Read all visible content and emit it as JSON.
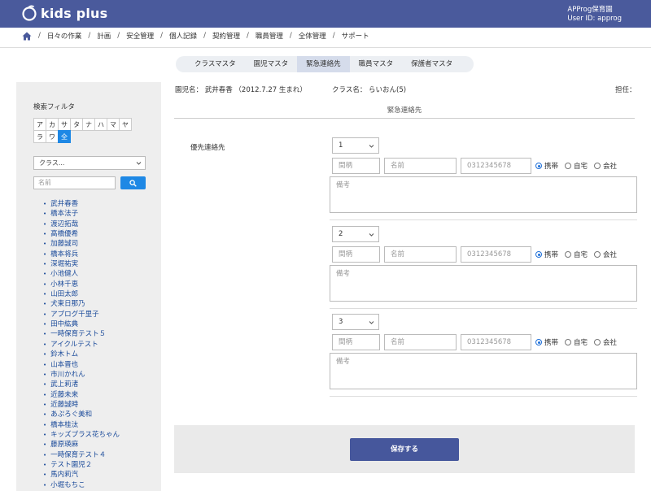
{
  "app": {
    "brand": "kids plus",
    "org_name": "APProg保育園",
    "user_id": "User ID: approg"
  },
  "breadcrumb": [
    "日々の作業",
    "計画",
    "安全管理",
    "個人記録",
    "契約管理",
    "職員管理",
    "全体管理",
    "サポート"
  ],
  "tabs": [
    {
      "label": "クラスマスタ",
      "active": false
    },
    {
      "label": "園児マスタ",
      "active": false
    },
    {
      "label": "緊急連絡先",
      "active": true
    },
    {
      "label": "職員マスタ",
      "active": false
    },
    {
      "label": "保護者マスタ",
      "active": false
    }
  ],
  "sidebar": {
    "filter_title": "検索フィルタ",
    "kana_row1": [
      "ア",
      "カ",
      "サ",
      "タ",
      "ナ",
      "ハ",
      "マ",
      "ヤ"
    ],
    "kana_row2": [
      "ラ",
      "ワ",
      "全"
    ],
    "class_select": "クラス...",
    "name_placeholder": "名前",
    "children": [
      "武井春香",
      "橋本法子",
      "渡辺拓哉",
      "高橋優希",
      "加藤誠司",
      "橋本将兵",
      "深堀祐実",
      "小池健人",
      "小林千恵",
      "山田太郎",
      "犬束日那乃",
      "アプログ千里子",
      "田中紘典",
      "一時保育テスト５",
      "アイクルテスト",
      "鈴木トム",
      "山本晋也",
      "市川かれん",
      "武上莉渚",
      "近藤未来",
      "近藤誠時",
      "あぷろぐ美和",
      "橋本桂汰",
      "キッズプラス花ちゃん",
      "藤原瑛麻",
      "一時保育テスト４",
      "テスト園児２",
      "馬内莉汽",
      "小堀もちこ"
    ]
  },
  "info": {
    "child": "園児名： 武井春香 （2012.7.27 生まれ）",
    "class": "クラス名： らいおん(5)",
    "teacher": "担任："
  },
  "section_title": "緊急連絡先",
  "priority_label": "優先連絡先",
  "contacts": [
    {
      "priority": "1",
      "relation_placeholder": "間柄",
      "name_placeholder": "名前",
      "phone_placeholder": "0312345678",
      "note_placeholder": "備考",
      "radio": [
        "携帯",
        "自宅",
        "会社"
      ]
    },
    {
      "priority": "2",
      "relation_placeholder": "間柄",
      "name_placeholder": "名前",
      "phone_placeholder": "0312345678",
      "note_placeholder": "備考",
      "radio": [
        "携帯",
        "自宅",
        "会社"
      ]
    },
    {
      "priority": "3",
      "relation_placeholder": "間柄",
      "name_placeholder": "名前",
      "phone_placeholder": "0312345678",
      "note_placeholder": "備考",
      "radio": [
        "携帯",
        "自宅",
        "会社"
      ]
    }
  ],
  "save_label": "保存する",
  "colors": {
    "header": "#4a5a9c",
    "accent": "#1e88e5",
    "save_button": "#46579c"
  }
}
